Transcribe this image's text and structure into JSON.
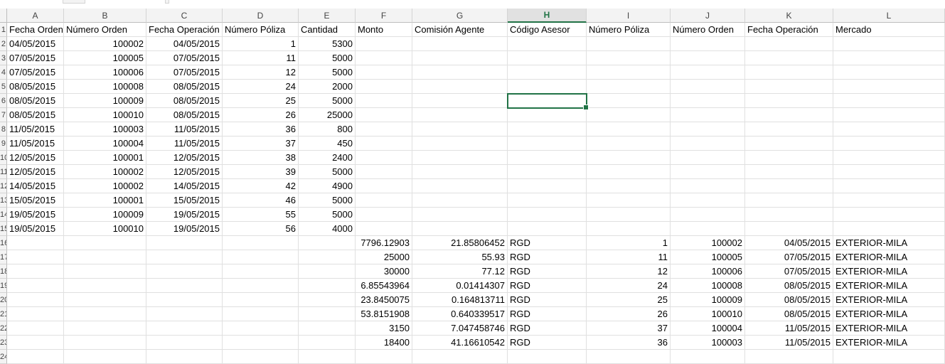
{
  "columns": [
    "A",
    "B",
    "C",
    "D",
    "E",
    "F",
    "G",
    "H",
    "I",
    "J",
    "K",
    "L"
  ],
  "selected_column": "H",
  "row_numbers": [
    "1",
    "2",
    "3",
    "4",
    "5",
    "6",
    "7",
    "8",
    "9",
    "10",
    "11",
    "12",
    "13",
    "14",
    "15",
    "16",
    "17",
    "18",
    "19",
    "20",
    "21",
    "22",
    "23",
    "24"
  ],
  "headers": [
    "Fecha Orden",
    "Número Orden",
    "Fecha Operación",
    "Número Póliza",
    "Cantidad",
    "Monto",
    "Comisión Agente",
    "Código Asesor",
    "Número Póliza",
    "Número Orden",
    "Fecha Operación",
    "Mercado"
  ],
  "rows_left": [
    [
      "04/05/2015",
      "100002",
      "04/05/2015",
      "1",
      "5300"
    ],
    [
      "07/05/2015",
      "100005",
      "07/05/2015",
      "11",
      "5000"
    ],
    [
      "07/05/2015",
      "100006",
      "07/05/2015",
      "12",
      "5000"
    ],
    [
      "08/05/2015",
      "100008",
      "08/05/2015",
      "24",
      "2000"
    ],
    [
      "08/05/2015",
      "100009",
      "08/05/2015",
      "25",
      "5000"
    ],
    [
      "08/05/2015",
      "100010",
      "08/05/2015",
      "26",
      "25000"
    ],
    [
      "11/05/2015",
      "100003",
      "11/05/2015",
      "36",
      "800"
    ],
    [
      "11/05/2015",
      "100004",
      "11/05/2015",
      "37",
      "450"
    ],
    [
      "12/05/2015",
      "100001",
      "12/05/2015",
      "38",
      "2400"
    ],
    [
      "12/05/2015",
      "100002",
      "12/05/2015",
      "39",
      "5000"
    ],
    [
      "14/05/2015",
      "100002",
      "14/05/2015",
      "42",
      "4900"
    ],
    [
      "15/05/2015",
      "100001",
      "15/05/2015",
      "46",
      "5000"
    ],
    [
      "19/05/2015",
      "100009",
      "19/05/2015",
      "55",
      "5000"
    ],
    [
      "19/05/2015",
      "100010",
      "19/05/2015",
      "56",
      "4000"
    ]
  ],
  "rows_right": [
    [
      "7796.12903",
      "21.85806452",
      "RGD",
      "1",
      "100002",
      "04/05/2015",
      "EXTERIOR-MILA"
    ],
    [
      "25000",
      "55.93",
      "RGD",
      "11",
      "100005",
      "07/05/2015",
      "EXTERIOR-MILA"
    ],
    [
      "30000",
      "77.12",
      "RGD",
      "12",
      "100006",
      "07/05/2015",
      "EXTERIOR-MILA"
    ],
    [
      "6.85543964",
      "0.01414307",
      "RGD",
      "24",
      "100008",
      "08/05/2015",
      "EXTERIOR-MILA"
    ],
    [
      "23.8450075",
      "0.164813711",
      "RGD",
      "25",
      "100009",
      "08/05/2015",
      "EXTERIOR-MILA"
    ],
    [
      "53.8151908",
      "0.640339517",
      "RGD",
      "26",
      "100010",
      "08/05/2015",
      "EXTERIOR-MILA"
    ],
    [
      "3150",
      "7.047458746",
      "RGD",
      "37",
      "100004",
      "11/05/2015",
      "EXTERIOR-MILA"
    ],
    [
      "18400",
      "41.16610542",
      "RGD",
      "36",
      "100003",
      "11/05/2015",
      "EXTERIOR-MILA"
    ]
  ],
  "selected_cell": "H5",
  "colors": {
    "accent": "#217346",
    "gridline": "#e0e0e0",
    "header_bg": "#f3f3f3"
  }
}
